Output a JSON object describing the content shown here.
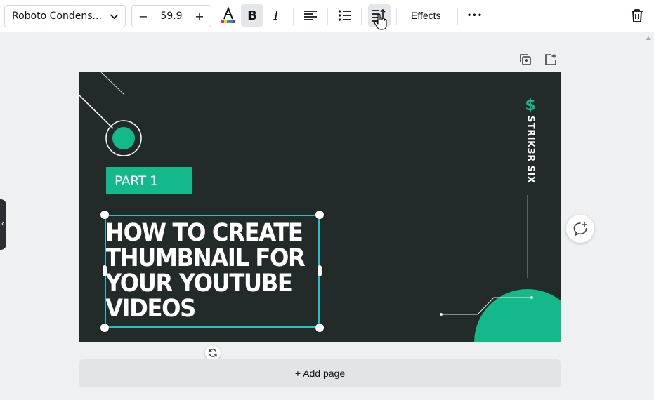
{
  "toolbar": {
    "font_family": "Roboto Condens...",
    "font_size": "59.9",
    "decrease_label": "−",
    "increase_label": "+",
    "bold_label": "B",
    "italic_label": "I",
    "effects_label": "Effects",
    "more_label": "•••",
    "text_color_rainbow": [
      "#e53935",
      "#fdd835",
      "#43a047",
      "#1e88e5",
      "#8e24aa"
    ]
  },
  "design": {
    "part_label": "PART 1",
    "headline": "HOW TO CREATE\nTHUMBNAIL FOR\nYOUR YOUTUBE\nVIDEOS",
    "brand_logo": "$",
    "brand_name": "STRIK3R SIX",
    "background_color": "#232b2a",
    "accent_color": "#13b98a"
  },
  "selection": {
    "border_color": "#21c2cf"
  },
  "add_page_label": "+ Add page"
}
